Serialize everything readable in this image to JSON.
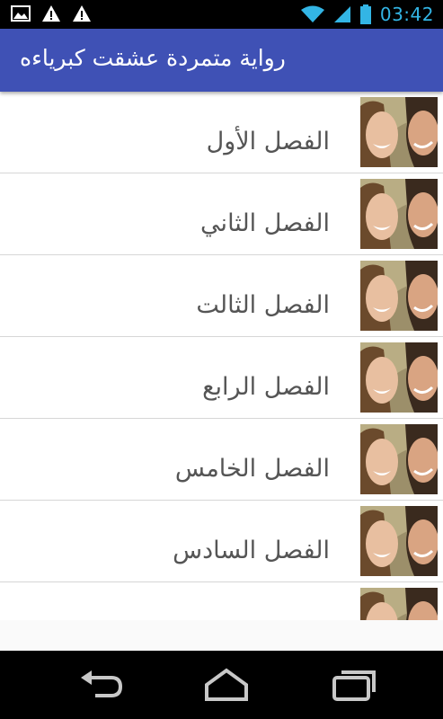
{
  "status_bar": {
    "time": "03:42",
    "left_icons": [
      "image-icon",
      "warning-icon",
      "warning-icon"
    ],
    "right_icons": [
      "wifi-icon",
      "signal-icon",
      "battery-icon"
    ],
    "accent_color": "#33b5e5"
  },
  "app_bar": {
    "title": "رواية متمردة عشقت كبرياءه",
    "color": "#3f51b5"
  },
  "chapters": [
    {
      "label": "الفصل الأول"
    },
    {
      "label": "الفصل الثاني"
    },
    {
      "label": "الفصل الثالت"
    },
    {
      "label": "الفصل الرابع"
    },
    {
      "label": "الفصل الخامس"
    },
    {
      "label": "الفصل السادس"
    },
    {
      "label": ""
    }
  ],
  "nav_bar": {
    "buttons": [
      "back-icon",
      "home-icon",
      "recent-apps-icon"
    ]
  }
}
